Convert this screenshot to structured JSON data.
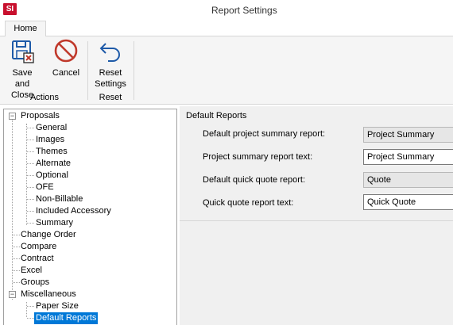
{
  "window": {
    "app_logo": "SI",
    "title": "Report Settings"
  },
  "ribbon": {
    "tab": "Home",
    "save_close": "Save and\nClose",
    "save_close_l1": "Save and",
    "save_close_l2": "Close",
    "cancel": "Cancel",
    "reset_l1": "Reset",
    "reset_l2": "Settings",
    "group_actions": "Actions",
    "group_reset": "Reset"
  },
  "tree": {
    "proposals": "Proposals",
    "proposal_children": [
      "General",
      "Images",
      "Themes",
      "Alternate",
      "Optional",
      "OFE",
      "Non-Billable",
      "Included Accessory",
      "Summary"
    ],
    "top_level": [
      "Change Order",
      "Compare",
      "Contract",
      "Excel",
      "Groups"
    ],
    "miscellaneous": "Miscellaneous",
    "misc_children": [
      "Paper Size",
      "Default Reports"
    ],
    "selected": "Default Reports"
  },
  "panel": {
    "title": "Default Reports",
    "rows": [
      {
        "label": "Default project summary report:",
        "value": "Project Summary",
        "readonly": true
      },
      {
        "label": "Project summary report text:",
        "value": "Project Summary",
        "readonly": false
      },
      {
        "label": "Default quick quote report:",
        "value": "Quote",
        "readonly": true
      },
      {
        "label": "Quick quote report text:",
        "value": "Quick Quote",
        "readonly": false
      }
    ]
  },
  "colors": {
    "accent": "#0078d7",
    "logo": "#c8102e",
    "cancel_icon": "#c0392b",
    "icon_blue": "#1e5aa8"
  },
  "icons": {
    "save": "save-close-icon",
    "cancel": "cancel-icon",
    "reset": "reset-icon",
    "expand": "collapse-box-icon"
  }
}
